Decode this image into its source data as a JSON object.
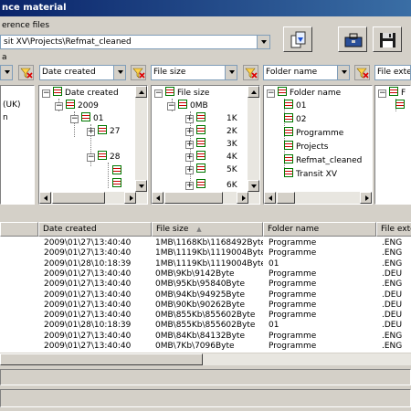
{
  "window": {
    "title": "nce material"
  },
  "reference": {
    "label": "erence files",
    "path": "sit XV\\Projects\\Refmat_cleaned"
  },
  "criteria_label": "a",
  "filters": [
    {
      "value": ""
    },
    {
      "value": "Date created"
    },
    {
      "value": "File size"
    },
    {
      "value": "Folder name"
    },
    {
      "value": "File exter"
    }
  ],
  "tree_lang": {
    "items": [
      "(UK)",
      "n"
    ]
  },
  "tree_date": {
    "root": "Date created",
    "year": "2009",
    "month": "01",
    "d1": "27",
    "d2": "28"
  },
  "tree_size": {
    "root": "File size",
    "bucket": "0MB",
    "items": [
      "1K",
      "2K",
      "3K",
      "4K",
      "5K",
      "6K"
    ]
  },
  "tree_folder": {
    "root": "Folder name",
    "items": [
      "01",
      "02",
      "Programme",
      "Projects",
      "Refmat_cleaned",
      "Transit XV"
    ]
  },
  "tree_ext": {
    "root": "F"
  },
  "grid": {
    "columns": [
      "",
      "Date created",
      "File size",
      "Folder name",
      "File exte"
    ],
    "sort_indicator": "▲",
    "rows": [
      [
        "",
        "2009\\01\\27\\13:40:40",
        "1MB\\1168Kb\\1168492Byte",
        "Programme",
        ".ENG"
      ],
      [
        "",
        "2009\\01\\27\\13:40:40",
        "1MB\\1119Kb\\1119004Byte",
        "Programme",
        ".ENG"
      ],
      [
        "",
        "2009\\01\\28\\10:18:39",
        "1MB\\1119Kb\\1119004Byte",
        "01",
        ".ENG"
      ],
      [
        "",
        "2009\\01\\27\\13:40:40",
        "0MB\\9Kb\\9142Byte",
        "Programme",
        ".DEU"
      ],
      [
        "",
        "2009\\01\\27\\13:40:40",
        "0MB\\95Kb\\95840Byte",
        "Programme",
        ".ENG"
      ],
      [
        "",
        "2009\\01\\27\\13:40:40",
        "0MB\\94Kb\\94925Byte",
        "Programme",
        ".DEU"
      ],
      [
        "",
        "2009\\01\\27\\13:40:40",
        "0MB\\90Kb\\90262Byte",
        "Programme",
        ".DEU"
      ],
      [
        "",
        "2009\\01\\27\\13:40:40",
        "0MB\\855Kb\\855602Byte",
        "Programme",
        ".DEU"
      ],
      [
        "",
        "2009\\01\\28\\10:18:39",
        "0MB\\855Kb\\855602Byte",
        "01",
        ".DEU"
      ],
      [
        "",
        "2009\\01\\27\\13:40:40",
        "0MB\\84Kb\\84132Byte",
        "Programme",
        ".ENG"
      ],
      [
        "",
        "2009\\01\\27\\13:40:40",
        "0MB\\7Kb\\7096Byte",
        "Programme",
        ".ENG"
      ]
    ]
  }
}
